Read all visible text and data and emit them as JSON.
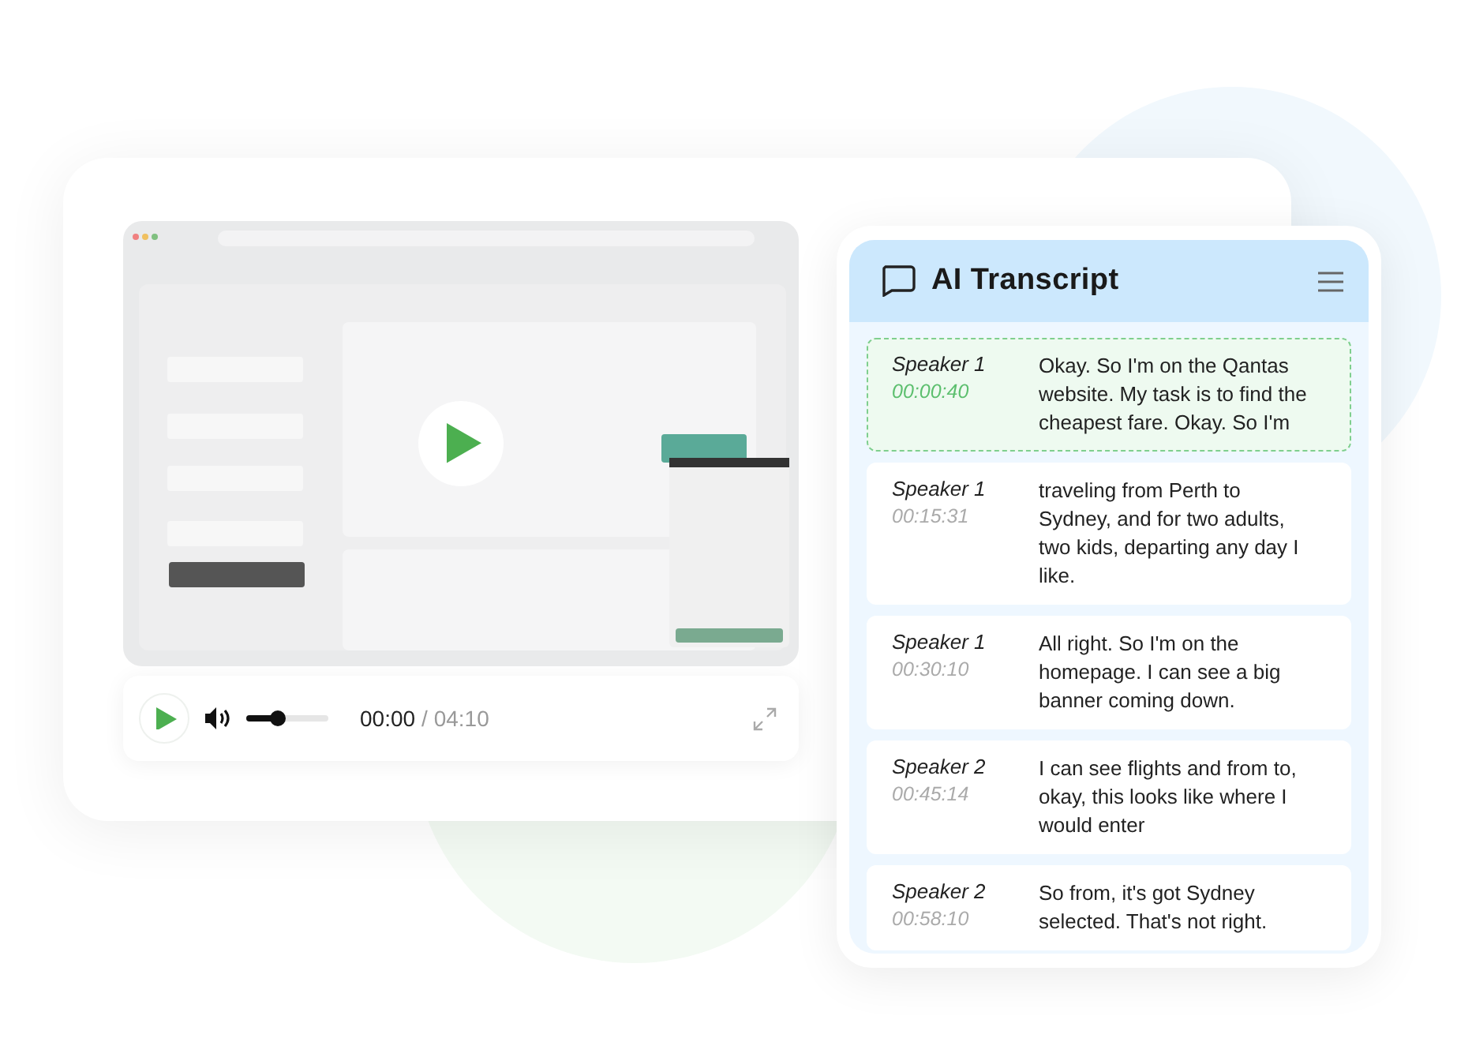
{
  "player": {
    "playing": false,
    "volume": {
      "level": 0.38
    },
    "time_current": "00:00",
    "time_total": "/ 04:10"
  },
  "transcript": {
    "title": "AI Transcript",
    "entries": [
      {
        "speaker": "Speaker 1",
        "time": "00:00:40",
        "text": "Okay. So I'm on the Qantas website. My task is to find the cheapest fare. Okay. So I'm",
        "selected": true
      },
      {
        "speaker": "Speaker 1",
        "time": "00:15:31",
        "text": "traveling from Perth to Sydney, and for two adults, two kids, departing any day I like.",
        "selected": false
      },
      {
        "speaker": "Speaker 1",
        "time": "00:30:10",
        "text": "All right. So I'm on the homepage. I can see a big banner coming down.",
        "selected": false
      },
      {
        "speaker": "Speaker 2",
        "time": "00:45:14",
        "text": "I can see flights and from to, okay, this looks like where I would enter",
        "selected": false
      },
      {
        "speaker": "Speaker 2",
        "time": "00:58:10",
        "text": "So from, it's got Sydney selected. That's not right.",
        "selected": false
      }
    ]
  }
}
